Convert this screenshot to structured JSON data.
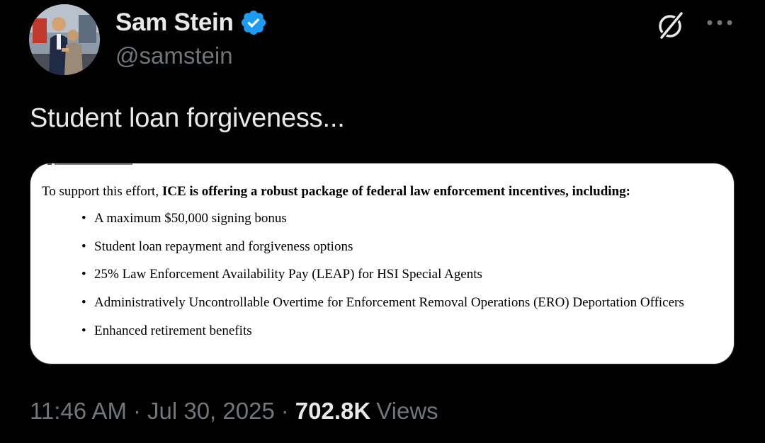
{
  "author": {
    "display_name": "Sam Stein",
    "handle": "@samstein",
    "verified": true,
    "verified_color": "#1d9bf0"
  },
  "header_icons": {
    "grok": "grok-icon",
    "more": "more-icon"
  },
  "tweet": {
    "text": "Student loan forgiveness..."
  },
  "media": {
    "intro_prefix": "To support this effort, ",
    "intro_bold": "ICE is offering a robust package of federal law enforcement incentives, including:",
    "bullet_symbol": "•",
    "bullets": [
      "A maximum $50,000 signing bonus",
      "Student loan repayment and forgiveness options",
      "25% Law Enforcement Availability Pay (LEAP) for HSI Special Agents",
      "Administratively Uncontrollable Overtime for Enforcement Removal Operations (ERO) Deportation Officers",
      "Enhanced retirement benefits"
    ]
  },
  "meta": {
    "time": "11:46 AM",
    "separator": "·",
    "date": "Jul 30, 2025",
    "views_count": "702.8K",
    "views_label": "Views"
  },
  "colors": {
    "background": "#000000",
    "primary_text": "#e7e9ea",
    "secondary_text": "#71767b",
    "accent": "#1d9bf0"
  }
}
